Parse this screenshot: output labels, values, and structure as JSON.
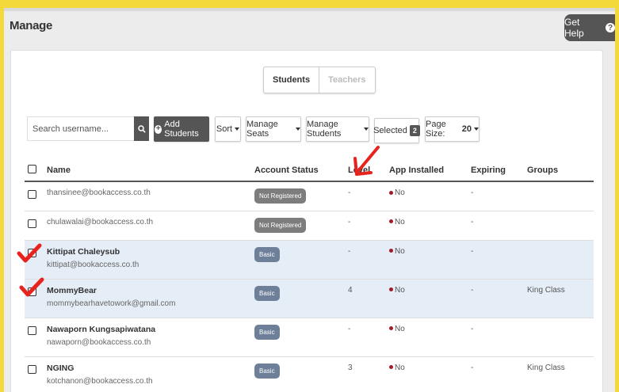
{
  "page": {
    "title": "Manage",
    "help_label": "Get Help"
  },
  "tabs": {
    "students": "Students",
    "teachers": "Teachers"
  },
  "toolbar": {
    "search_placeholder": "Search username...",
    "add_students": "Add Students",
    "sort": "Sort",
    "manage_seats": "Manage Seats",
    "manage_students": "Manage Students",
    "selected": "Selected",
    "selected_count": "2",
    "page_size": "Page Size:",
    "page_size_value": "20"
  },
  "table": {
    "headers": {
      "name": "Name",
      "status": "Account Status",
      "level": "Level",
      "app": "App Installed",
      "expiring": "Expiring",
      "groups": "Groups"
    },
    "rows": [
      {
        "name": "",
        "email": "thansinee@bookaccess.co.th",
        "status": "Not Registered",
        "level": "-",
        "app": "No",
        "expiring": "-",
        "groups": ""
      },
      {
        "name": "",
        "email": "chulawalai@bookaccess.co.th",
        "status": "Not Registered",
        "level": "-",
        "app": "No",
        "expiring": "-",
        "groups": ""
      },
      {
        "name": "Kittipat Chaleysub",
        "email": "kittipat@bookaccess.co.th",
        "status": "Basic",
        "level": "-",
        "app": "No",
        "expiring": "-",
        "groups": ""
      },
      {
        "name": "MommyBear",
        "email": "mommybearhavetowork@gmail.com",
        "status": "Basic",
        "level": "4",
        "app": "No",
        "expiring": "-",
        "groups": "King Class"
      },
      {
        "name": "Nawaporn Kungsapiwatana",
        "email": "nawaporn@bookaccess.co.th",
        "status": "Basic",
        "level": "-",
        "app": "No",
        "expiring": "-",
        "groups": ""
      },
      {
        "name": "NGING",
        "email": "kotchanon@bookaccess.co.th",
        "status": "Basic",
        "level": "3",
        "app": "No",
        "expiring": "-",
        "groups": "King Class"
      }
    ]
  },
  "colors": {
    "background": "#f4d93b",
    "dark_button": "#555555",
    "not_registered_badge": "#7d7d7d",
    "basic_badge": "#6d7f99",
    "app_no_dot": "#a01c2a",
    "selected_row": "#e5edf6",
    "annotation_red": "#e8231e"
  },
  "icons": {
    "search": "search-icon",
    "help": "question-circle-icon",
    "add": "plus-circle-icon",
    "annotation_check": "red-check-mark-icon",
    "annotation_arrow": "red-arrow-icon"
  }
}
